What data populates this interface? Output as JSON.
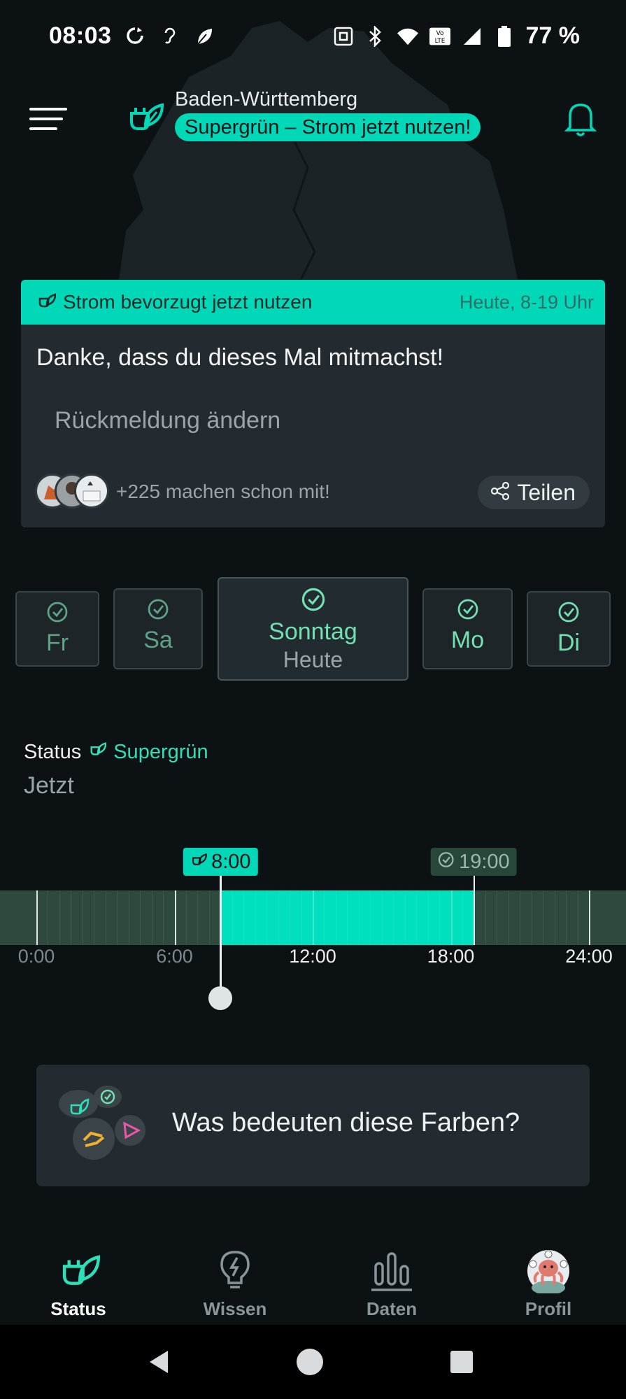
{
  "status_bar": {
    "time": "08:03",
    "battery": "77 %",
    "left_icons": [
      "sync-icon",
      "hearing-icon",
      "leaf-app-icon"
    ],
    "right_icons": [
      "nfc-icon",
      "bluetooth-icon",
      "wifi-icon",
      "volte-icon",
      "signal-icon",
      "battery-icon"
    ]
  },
  "header": {
    "region": "Baden-Württemberg",
    "status_pill": "Supergrün – Strom jetzt nutzen!",
    "menu_icon": "hamburger-menu-icon",
    "logo_icon": "plug-leaf-icon",
    "bell_icon": "bell-icon"
  },
  "card": {
    "head_title": "Strom bevorzugt jetzt nutzen",
    "head_time": "Heute, 8-19 Uhr",
    "message": "Danke, dass du dieses Mal mitmachst!",
    "change_feedback": "Rückmeldung ändern",
    "participants": "+225 machen schon mit!",
    "share_label": "Teilen"
  },
  "days": [
    {
      "label": "Fr",
      "state": "past"
    },
    {
      "label": "Sa",
      "state": "past"
    },
    {
      "label": "Sonntag",
      "sub": "Heute",
      "state": "today"
    },
    {
      "label": "Mo",
      "state": "future"
    },
    {
      "label": "Di",
      "state": "future"
    }
  ],
  "status": {
    "key": "Status",
    "value": "Supergrün",
    "time": "Jetzt"
  },
  "timeline": {
    "start_marker": "8:00",
    "end_marker": "19:00",
    "labels": [
      "0:00",
      "6:00",
      "12:00",
      "18:00",
      "24:00"
    ],
    "green_from_hour": 8,
    "green_to_hour": 19,
    "current_hour": 8
  },
  "info": {
    "text": "Was bedeuten diese Farben?"
  },
  "nav": {
    "items": [
      {
        "label": "Status",
        "icon": "plug-leaf-icon"
      },
      {
        "label": "Wissen",
        "icon": "lightbulb-icon"
      },
      {
        "label": "Daten",
        "icon": "bar-chart-icon"
      },
      {
        "label": "Profil",
        "icon": "octopus-avatar-icon"
      }
    ]
  },
  "colors": {
    "accent": "#00d8b8",
    "background": "#0c1114",
    "card": "#232b30",
    "green_text": "#73e0b2"
  }
}
